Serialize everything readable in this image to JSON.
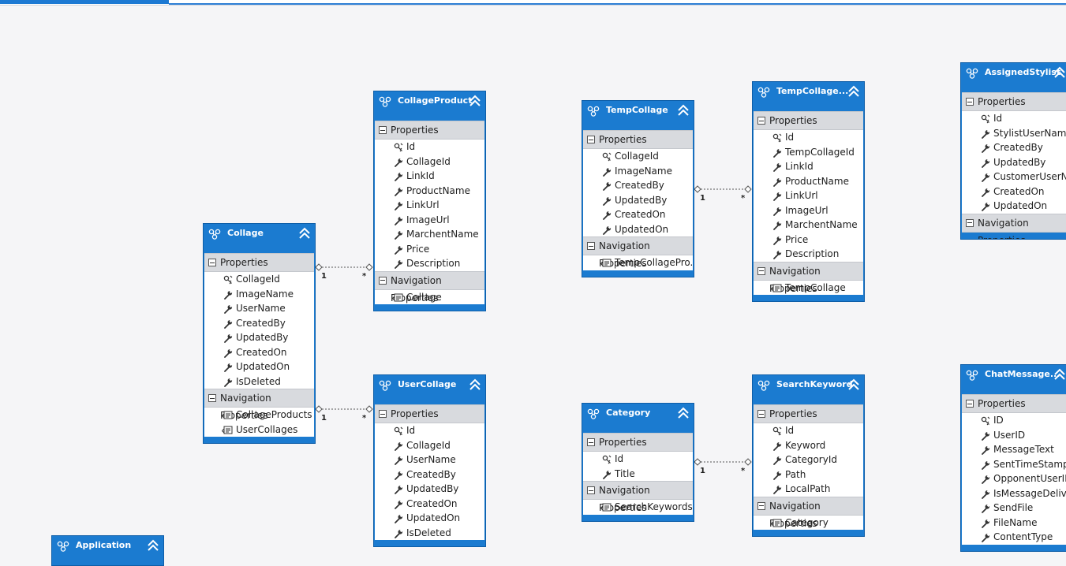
{
  "entities": [
    {
      "id": "collage",
      "title": "Collage",
      "properties": [
        {
          "name": "CollageId",
          "key": true
        },
        {
          "name": "ImageName"
        },
        {
          "name": "UserName"
        },
        {
          "name": "CreatedBy"
        },
        {
          "name": "UpdatedBy"
        },
        {
          "name": "CreatedOn"
        },
        {
          "name": "UpdatedOn"
        },
        {
          "name": "IsDeleted"
        }
      ],
      "navigation": [
        "CollageProducts",
        "UserCollages"
      ]
    },
    {
      "id": "collageproduct",
      "title": "CollageProduct",
      "properties": [
        {
          "name": "Id",
          "key": true
        },
        {
          "name": "CollageId"
        },
        {
          "name": "LinkId"
        },
        {
          "name": "ProductName"
        },
        {
          "name": "LinkUrl"
        },
        {
          "name": "ImageUrl"
        },
        {
          "name": "MarchentName"
        },
        {
          "name": "Price"
        },
        {
          "name": "Description"
        }
      ],
      "navigation": [
        "Collage"
      ]
    },
    {
      "id": "usercollage",
      "title": "UserCollage",
      "properties": [
        {
          "name": "Id",
          "key": true
        },
        {
          "name": "CollageId"
        },
        {
          "name": "UserName"
        },
        {
          "name": "CreatedBy"
        },
        {
          "name": "UpdatedBy"
        },
        {
          "name": "CreatedOn"
        },
        {
          "name": "UpdatedOn"
        },
        {
          "name": "IsDeleted"
        }
      ],
      "navigation": []
    },
    {
      "id": "tempcollage",
      "title": "TempCollage",
      "properties": [
        {
          "name": "CollageId",
          "key": true
        },
        {
          "name": "ImageName"
        },
        {
          "name": "CreatedBy"
        },
        {
          "name": "UpdatedBy"
        },
        {
          "name": "CreatedOn"
        },
        {
          "name": "UpdatedOn"
        }
      ],
      "navigation": [
        "TempCollagePro..."
      ]
    },
    {
      "id": "tempcollageproduct",
      "title": "TempCollage...",
      "properties": [
        {
          "name": "Id",
          "key": true
        },
        {
          "name": "TempCollageId"
        },
        {
          "name": "LinkId"
        },
        {
          "name": "ProductName"
        },
        {
          "name": "LinkUrl"
        },
        {
          "name": "ImageUrl"
        },
        {
          "name": "MarchentName"
        },
        {
          "name": "Price"
        },
        {
          "name": "Description"
        }
      ],
      "navigation": [
        "TempCollage"
      ]
    },
    {
      "id": "assignedstylist",
      "title": "AssignedStylist",
      "properties": [
        {
          "name": "Id",
          "key": true
        },
        {
          "name": "StylistUserName"
        },
        {
          "name": "CreatedBy"
        },
        {
          "name": "UpdatedBy"
        },
        {
          "name": "CustomerUserN..."
        },
        {
          "name": "CreatedOn"
        },
        {
          "name": "UpdatedOn"
        }
      ],
      "navigation": []
    },
    {
      "id": "category",
      "title": "Category",
      "properties": [
        {
          "name": "Id",
          "key": true
        },
        {
          "name": "Title"
        }
      ],
      "navigation": [
        "SearchKeywords"
      ]
    },
    {
      "id": "searchkeyword",
      "title": "SearchKeyword",
      "properties": [
        {
          "name": "Id",
          "key": true
        },
        {
          "name": "Keyword"
        },
        {
          "name": "CategoryId"
        },
        {
          "name": "Path"
        },
        {
          "name": "LocalPath"
        }
      ],
      "navigation": [
        "Category"
      ]
    },
    {
      "id": "chatmessage",
      "title": "ChatMessage...",
      "properties": [
        {
          "name": "ID",
          "key": true
        },
        {
          "name": "UserID"
        },
        {
          "name": "MessageText"
        },
        {
          "name": "SentTimeStamp"
        },
        {
          "name": "OpponentUserID"
        },
        {
          "name": "IsMessageDelive..."
        },
        {
          "name": "SendFile"
        },
        {
          "name": "FileName"
        },
        {
          "name": "ContentType"
        }
      ],
      "navigation": []
    },
    {
      "id": "application",
      "title": "Application",
      "properties": [],
      "navigation": []
    }
  ],
  "labels": {
    "properties": "Properties",
    "navigation": "Navigation Properties"
  },
  "associations": [
    {
      "from": "collage",
      "to": "collageproduct",
      "from_mult": "1",
      "to_mult": "*"
    },
    {
      "from": "collage",
      "to": "usercollage",
      "from_mult": "1",
      "to_mult": "*"
    },
    {
      "from": "tempcollage",
      "to": "tempcollageproduct",
      "from_mult": "1",
      "to_mult": "*"
    },
    {
      "from": "category",
      "to": "searchkeyword",
      "from_mult": "1",
      "to_mult": "*"
    }
  ],
  "colors": {
    "header": "#1b7bd0",
    "section": "#d8dade",
    "canvas": "#f5f5f7",
    "accent": "#1c79d3"
  }
}
